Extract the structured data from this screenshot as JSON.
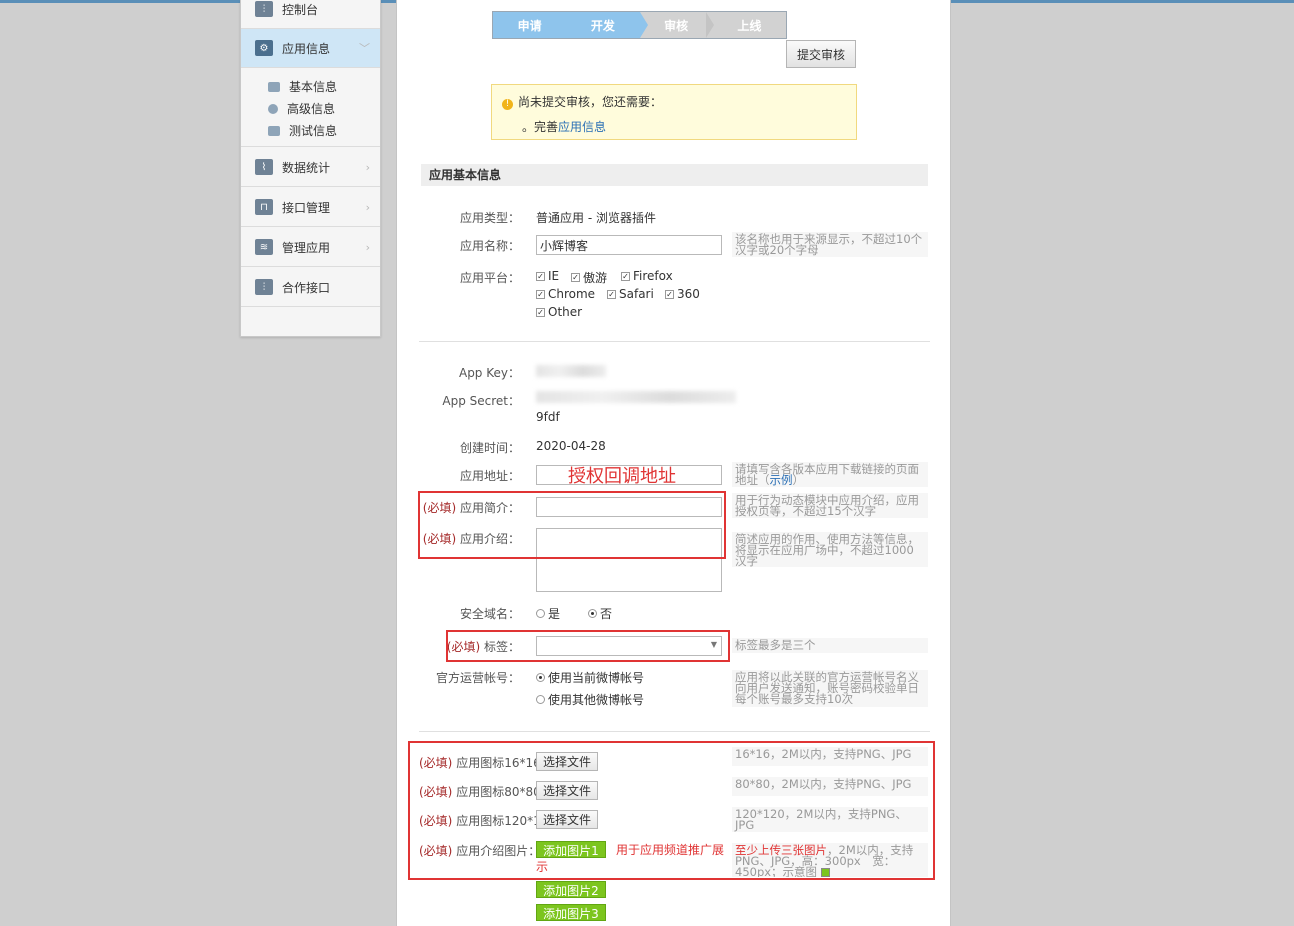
{
  "sidebar": {
    "items": [
      {
        "label": "控制台",
        "icon": "sliders-icon"
      },
      {
        "label": "应用信息",
        "icon": "gear-icon"
      },
      {
        "label": "数据统计",
        "icon": "chart-icon"
      },
      {
        "label": "接口管理",
        "icon": "plug-icon"
      },
      {
        "label": "管理应用",
        "icon": "layers-icon"
      },
      {
        "label": "合作接口",
        "icon": "sliders-icon"
      }
    ],
    "sub_items": [
      {
        "label": "基本信息",
        "icon": "card-icon"
      },
      {
        "label": "高级信息",
        "icon": "info-icon"
      },
      {
        "label": "测试信息",
        "icon": "test-icon"
      }
    ]
  },
  "steps": [
    "申请",
    "开发",
    "审核",
    "上线"
  ],
  "submit_button": "提交审核",
  "notice": {
    "text": "尚未提交审核，您还需要：",
    "bullet": "。完善",
    "link": "应用信息"
  },
  "section_title": "应用基本信息",
  "form": {
    "app_type_label": "应用类型：",
    "app_type_value": "普通应用 - 浏览器插件",
    "app_name_label": "应用名称：",
    "app_name_value": "小辉博客",
    "app_name_hint": "该名称也用于来源显示，不超过10个汉字或20个字母",
    "platform_label": "应用平台：",
    "platforms": [
      "IE",
      "傲游",
      "Firefox",
      "Chrome",
      "Safari",
      "360",
      "Other"
    ],
    "app_key_label": "App Key：",
    "app_secret_label": "App Secret：",
    "app_secret_tail": "9fdf",
    "created_label": "创建时间：",
    "created_value": "2020-04-28",
    "app_url_label": "应用地址：",
    "app_url_hint": "请填写含各版本应用下载链接的页面地址（",
    "app_url_hint_link": "示例",
    "app_url_hint_end": "）",
    "required_tag": "(必填)",
    "brief_label": "应用简介：",
    "brief_hint": "用于行为动态模块中应用介绍，应用授权页等，不超过15个汉字",
    "intro_label": "应用介绍：",
    "intro_hint": "简述应用的作用、使用方法等信息，将显示在应用广场中，不超过1000汉字",
    "secure_domain_label": "安全域名：",
    "secure_yes": "是",
    "secure_no": "否",
    "tag_label": "标签：",
    "tag_hint": "标签最多是三个",
    "official_label": "官方运营帐号：",
    "official_opt1": "使用当前微博帐号",
    "official_opt2": "使用其他微博帐号",
    "official_hint": "应用将以此关联的官方运营帐号名义向用户发送通知，账号密码校验单日每个账号最多支持10次",
    "icon16_label": "应用图标16*16",
    "icon80_label": "应用图标80*80",
    "icon120_label": "应用图标120*1",
    "choose_file": "选择文件",
    "icon16_hint": "16*16，2M以内，支持PNG、JPG",
    "icon80_hint": "80*80，2M以内，支持PNG、JPG",
    "icon120_hint": "120*120，2M以内，支持PNG、JPG",
    "intro_img_label": "应用介绍图片：",
    "add_img1": "添加图片1",
    "add_img2": "添加图片2",
    "add_img3": "添加图片3",
    "intro_img_note": "用于应用频道推广展示",
    "intro_img_hint_red": "至少上传三张图片",
    "intro_img_hint": "，2M以内，支持PNG、JPG，高：300px　宽：450px；示意图"
  },
  "annotation": "授权回调地址",
  "colors": {
    "accent": "#8ec4ec",
    "link": "#2a6fb5",
    "required": "#a52a2a",
    "annotation": "#e03434",
    "add_button": "#7cc51e"
  }
}
